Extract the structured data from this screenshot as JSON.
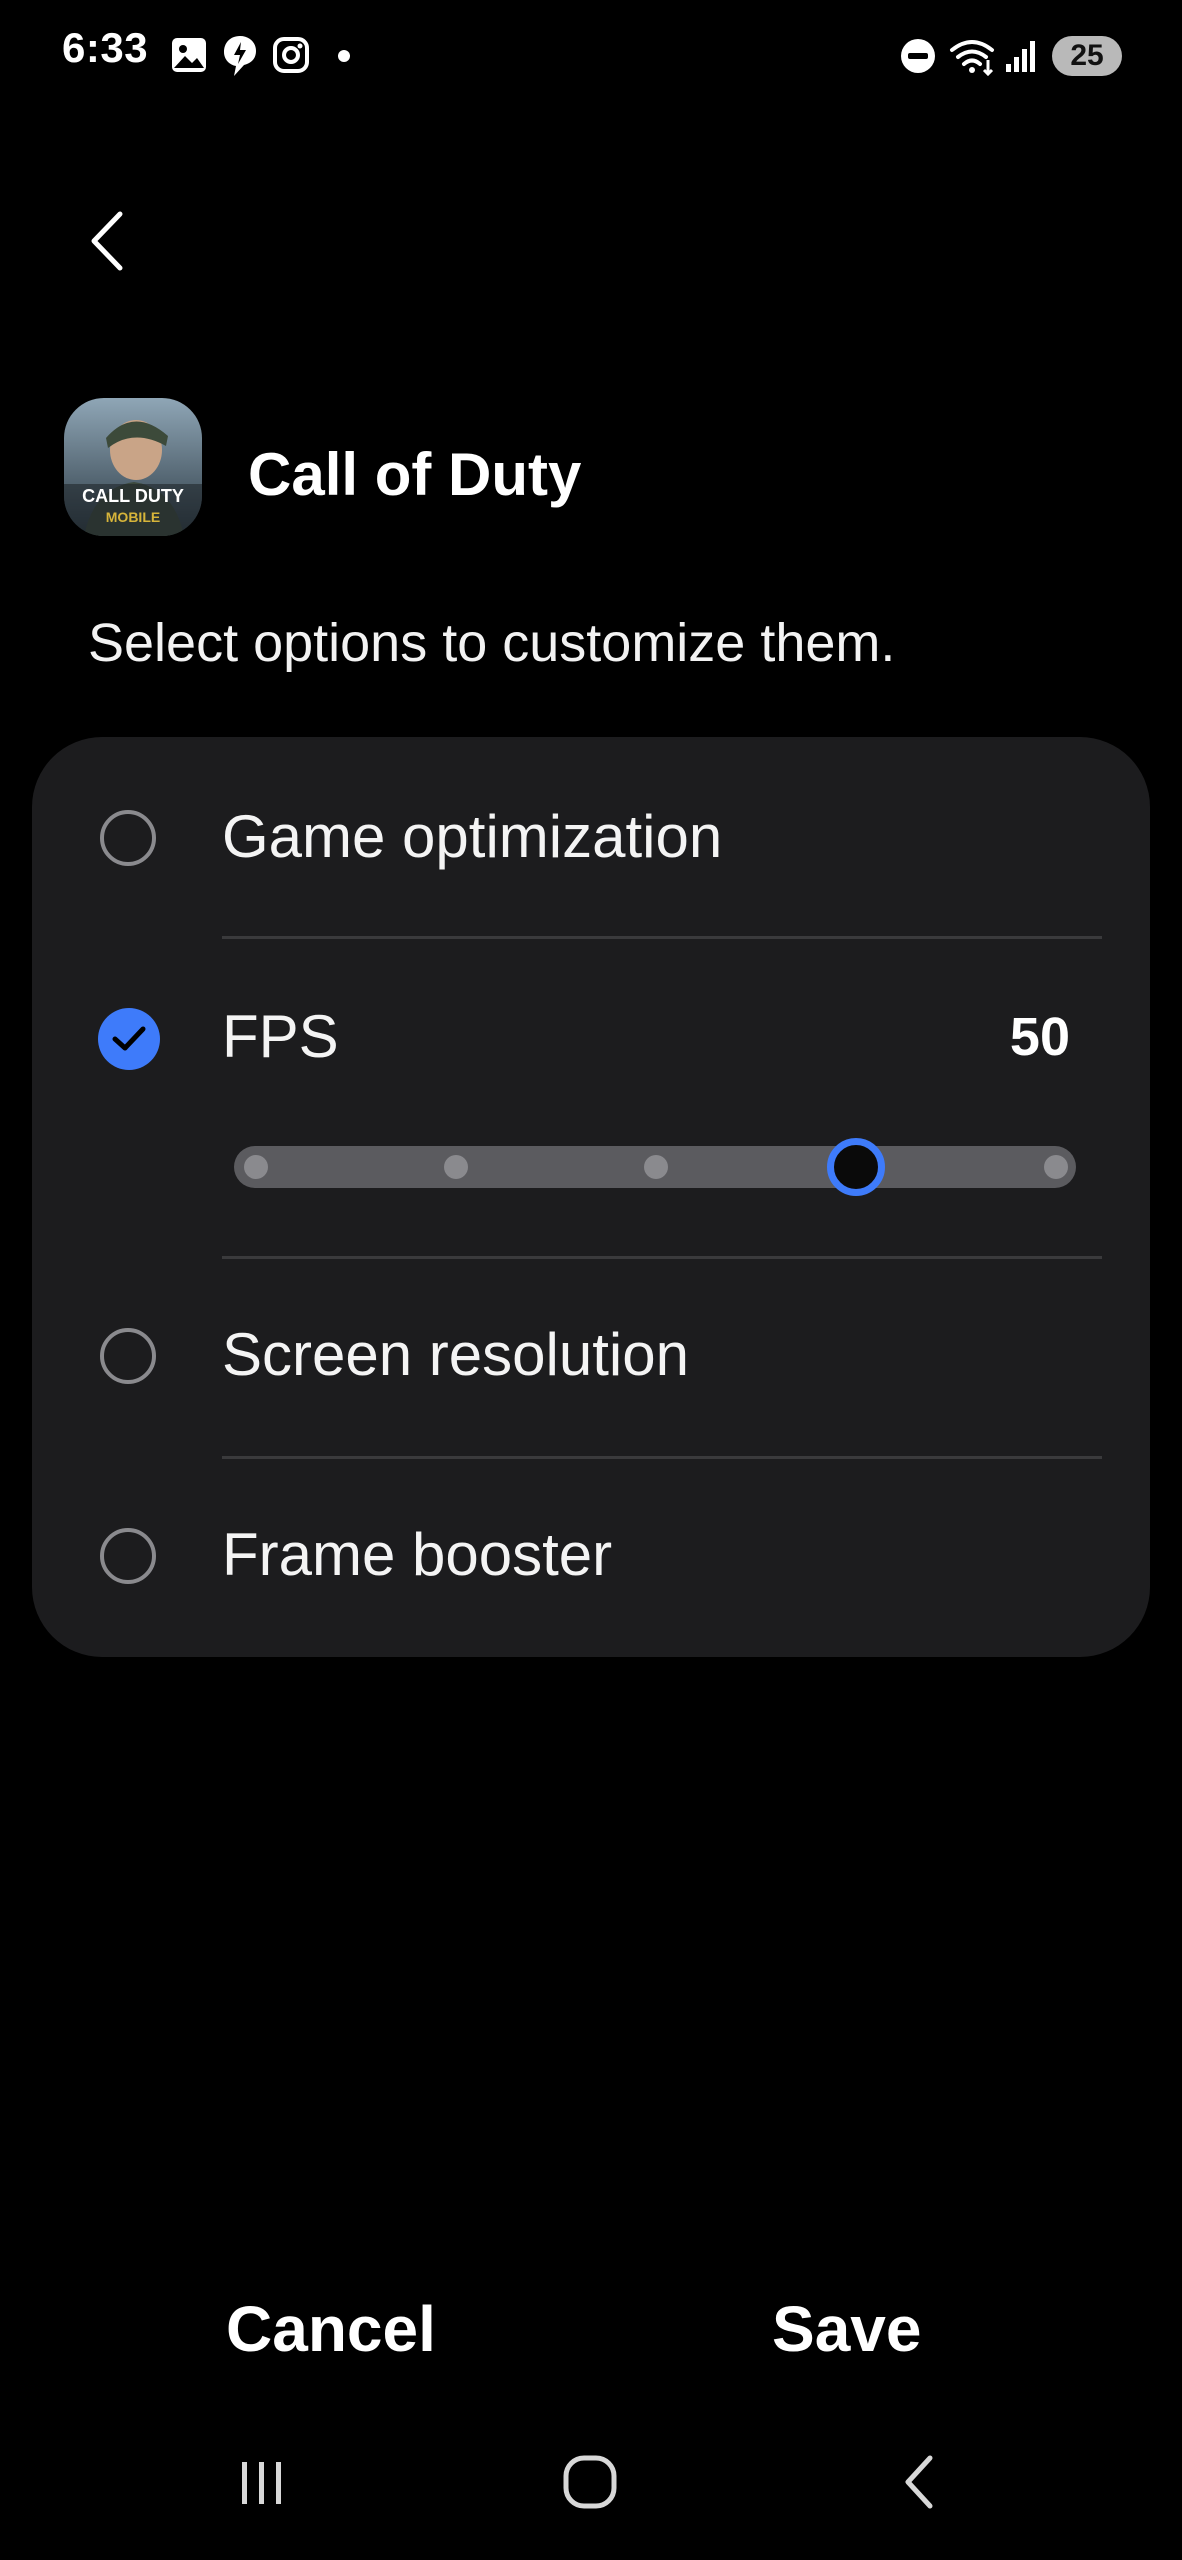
{
  "status_bar": {
    "time": "6:33",
    "battery": "25",
    "icons": [
      "gallery-icon",
      "bixby-icon",
      "instagram-icon",
      "notification-dot-icon",
      "dnd-icon",
      "wifi-icon",
      "signal-icon",
      "battery-icon"
    ]
  },
  "header": {
    "back_icon": "back-arrow-icon",
    "app_name": "Call of Duty",
    "app_icon": "call-of-duty-app-icon"
  },
  "subtitle": "Select options to customize them.",
  "options": [
    {
      "label": "Game optimization",
      "checked": false
    },
    {
      "label": "FPS",
      "checked": true,
      "value": "50"
    },
    {
      "label": "Screen resolution",
      "checked": false
    },
    {
      "label": "Frame booster",
      "checked": false
    }
  ],
  "fps_slider": {
    "steps": 5,
    "selected_index": 3
  },
  "footer": {
    "cancel": "Cancel",
    "save": "Save"
  },
  "colors": {
    "accent": "#3e7bfa",
    "card": "#1c1c1e",
    "background": "#000000"
  },
  "nav_bar": [
    "recents-icon",
    "home-icon",
    "back-icon"
  ]
}
